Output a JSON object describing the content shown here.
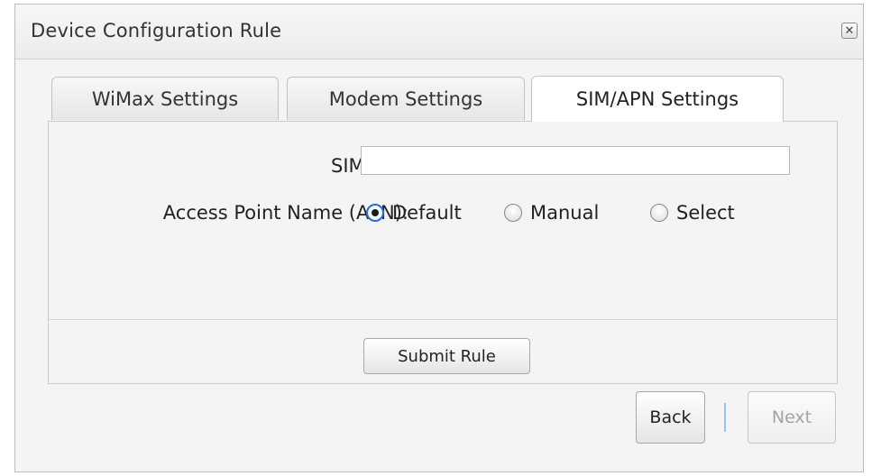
{
  "dialog": {
    "title": "Device Configuration Rule",
    "close_glyph": "✕"
  },
  "tabs": [
    {
      "label": "WiMax Settings",
      "active": false
    },
    {
      "label": "Modem Settings",
      "active": false
    },
    {
      "label": "SIM/APN Settings",
      "active": true
    }
  ],
  "form": {
    "sim_pin_label": "SIM PIN:",
    "sim_pin_value": "",
    "apn_label": "Access Point Name (APN):",
    "apn_options": [
      {
        "label": "Default",
        "checked": true
      },
      {
        "label": "Manual",
        "checked": false
      },
      {
        "label": "Select",
        "checked": false
      }
    ]
  },
  "actions": {
    "submit_label": "Submit Rule",
    "back_label": "Back",
    "next_label": "Next",
    "next_enabled": false
  },
  "colors": {
    "radio_focus": "#2a6fd6",
    "disabled_text": "#a3a3a3",
    "divider_accent": "#9ec0ea"
  }
}
